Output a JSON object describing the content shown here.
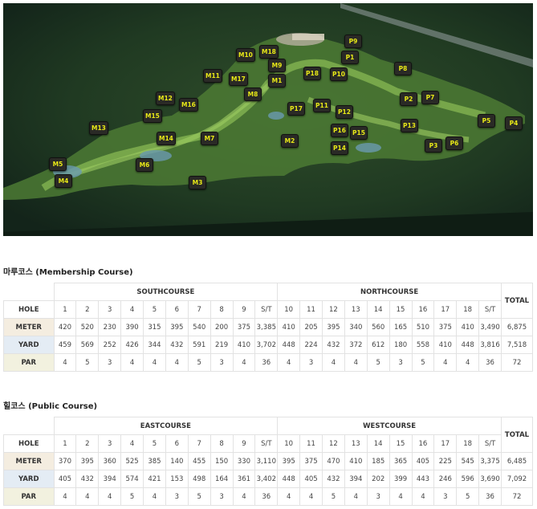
{
  "map": {
    "markers": [
      "P9",
      "P1",
      "M10",
      "M18",
      "M9",
      "M1",
      "M11",
      "M17",
      "M8",
      "P18",
      "P10",
      "P8",
      "M12",
      "M16",
      "P2",
      "P7",
      "M15",
      "P11",
      "P17",
      "P12",
      "M13",
      "M14",
      "M7",
      "M2",
      "P16",
      "P15",
      "P13",
      "P5",
      "P4",
      "P3",
      "P6",
      "P14",
      "M5",
      "M6",
      "M4",
      "M3"
    ]
  },
  "membership": {
    "title": "마루코스 (Membership Course)",
    "course_a": "SOUTHCOURSE",
    "course_b": "NORTHCOURSE",
    "total_label": "TOTAL",
    "hole_label": "HOLE",
    "holes": [
      "1",
      "2",
      "3",
      "4",
      "5",
      "6",
      "7",
      "8",
      "9",
      "S/T",
      "10",
      "11",
      "12",
      "13",
      "14",
      "15",
      "16",
      "17",
      "18",
      "S/T"
    ],
    "rows": [
      {
        "label": "METER",
        "values": [
          "420",
          "520",
          "230",
          "390",
          "315",
          "395",
          "540",
          "200",
          "375",
          "3,385",
          "410",
          "205",
          "395",
          "340",
          "560",
          "165",
          "510",
          "375",
          "410",
          "3,490"
        ],
        "total": "6,875"
      },
      {
        "label": "YARD",
        "values": [
          "459",
          "569",
          "252",
          "426",
          "344",
          "432",
          "591",
          "219",
          "410",
          "3,702",
          "448",
          "224",
          "432",
          "372",
          "612",
          "180",
          "558",
          "410",
          "448",
          "3,816"
        ],
        "total": "7,518"
      },
      {
        "label": "PAR",
        "values": [
          "4",
          "5",
          "3",
          "4",
          "4",
          "4",
          "5",
          "3",
          "4",
          "36",
          "4",
          "3",
          "4",
          "4",
          "5",
          "3",
          "5",
          "4",
          "4",
          "36"
        ],
        "total": "72"
      }
    ]
  },
  "public": {
    "title": "힐코스 (Public Course)",
    "course_a": "EASTCOURSE",
    "course_b": "WESTCOURSE",
    "total_label": "TOTAL",
    "hole_label": "HOLE",
    "holes": [
      "1",
      "2",
      "3",
      "4",
      "5",
      "6",
      "7",
      "8",
      "9",
      "S/T",
      "10",
      "11",
      "12",
      "13",
      "14",
      "15",
      "16",
      "17",
      "18",
      "S/T"
    ],
    "rows": [
      {
        "label": "METER",
        "values": [
          "370",
          "395",
          "360",
          "525",
          "385",
          "140",
          "455",
          "150",
          "330",
          "3,110",
          "395",
          "375",
          "470",
          "410",
          "185",
          "365",
          "405",
          "225",
          "545",
          "3,375"
        ],
        "total": "6,485"
      },
      {
        "label": "YARD",
        "values": [
          "405",
          "432",
          "394",
          "574",
          "421",
          "153",
          "498",
          "164",
          "361",
          "3,402",
          "448",
          "405",
          "432",
          "394",
          "202",
          "399",
          "443",
          "246",
          "596",
          "3,690"
        ],
        "total": "7,092"
      },
      {
        "label": "PAR",
        "values": [
          "4",
          "4",
          "4",
          "5",
          "4",
          "3",
          "5",
          "3",
          "4",
          "36",
          "4",
          "4",
          "5",
          "4",
          "3",
          "4",
          "4",
          "3",
          "5",
          "36"
        ],
        "total": "72"
      }
    ]
  }
}
